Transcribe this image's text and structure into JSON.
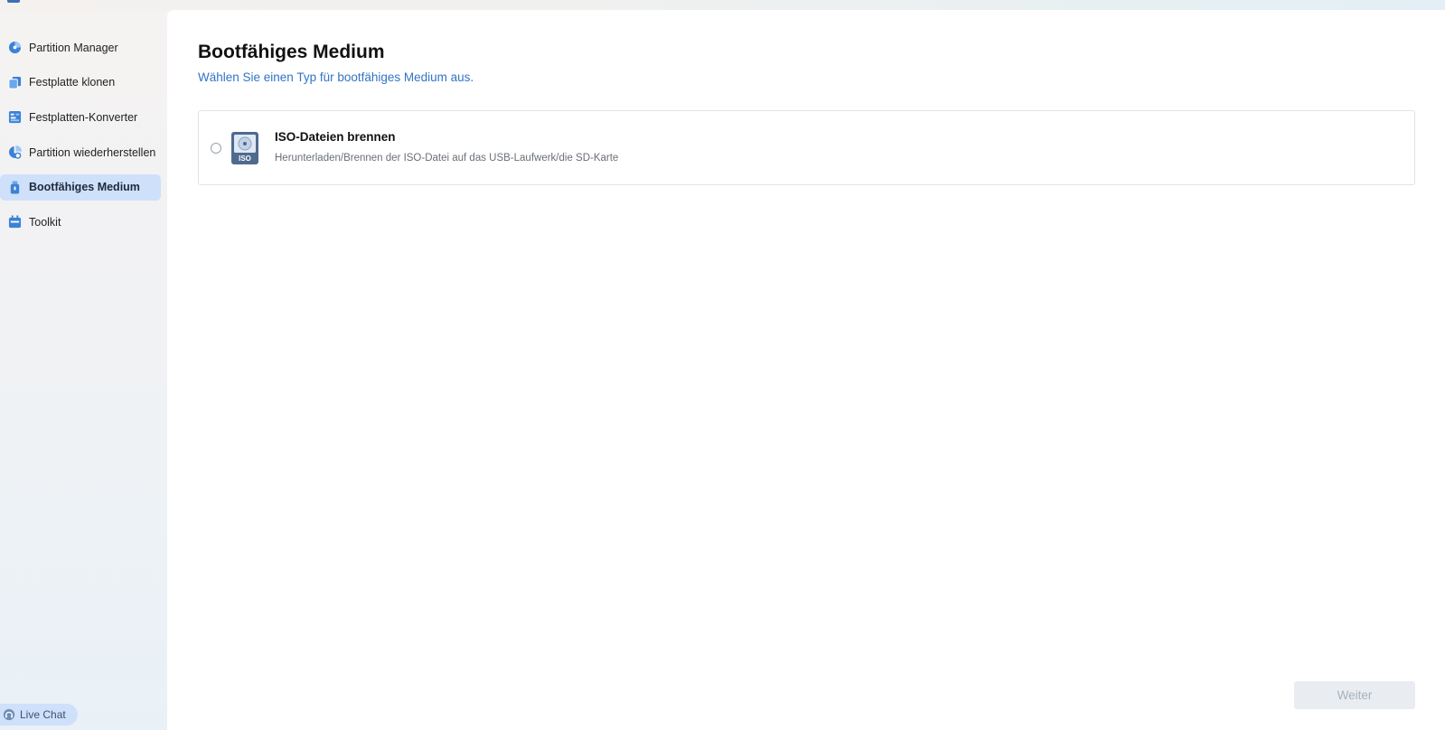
{
  "sidebar": {
    "items": [
      {
        "label": "Partition Manager",
        "icon": "pie-chart-icon"
      },
      {
        "label": "Festplatte klonen",
        "icon": "clone-disk-icon"
      },
      {
        "label": "Festplatten-Konverter",
        "icon": "converter-icon"
      },
      {
        "label": "Partition wiederherstellen",
        "icon": "recover-partition-icon"
      },
      {
        "label": "Bootfähiges Medium",
        "icon": "usb-drive-icon",
        "active": true
      },
      {
        "label": "Toolkit",
        "icon": "toolkit-icon"
      }
    ],
    "live_chat_label": "Live Chat"
  },
  "main": {
    "title": "Bootfähiges Medium",
    "subtitle": "Wählen Sie einen Typ für bootfähiges Medium aus.",
    "options": [
      {
        "title": "ISO-Dateien brennen",
        "description": "Herunterladen/Brennen der ISO-Datei auf das USB-Laufwerk/die SD-Karte",
        "icon_text": "ISO",
        "selected": false
      }
    ],
    "next_label": "Weiter"
  },
  "colors": {
    "accent": "#3373c4",
    "active_nav_bg": "#cfe0fa",
    "icon_blue": "#3b82d6"
  }
}
